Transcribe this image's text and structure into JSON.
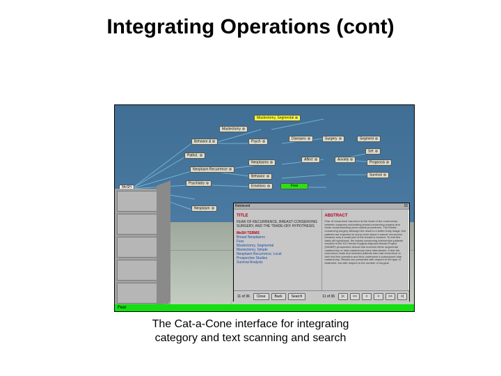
{
  "title": "Integrating Operations (cont)",
  "caption_l1": "The Cat-a-Cone interface for integrating",
  "caption_l2": "category and text scanning and search",
  "status_text": "Fear",
  "root_label": "MeSH",
  "nodes": {
    "n1": "Mastectomy",
    "n2": "Behavior &",
    "n3": "Pathol.",
    "n4": "Mastectomy, Segmental",
    "n5": "Psych",
    "n6": "Neoplasms",
    "n7": "Diseases",
    "n8": "Surgery",
    "n9": "Segment",
    "n10": "Neoplasm Recurrence",
    "n11": "Behavior",
    "n12": "Emotions",
    "n13": "Fear",
    "n14": "Psychiatry",
    "n15": "Affect",
    "n16": "Anxiety",
    "n17": "Set",
    "n18": "Prognosis",
    "n19": "Survival",
    "n20": "Neoplasm"
  },
  "doc": {
    "topbar_left": "Retrieved",
    "topbar_right": "15",
    "title_h": "TITLE",
    "title_lines": "FEAR OF RECURRENCE, BREAST-CONSERVING SURGERY, AND THE TRADE-OFF HYPOTHESIS",
    "mesh_h": "MeSH TERMS",
    "terms": [
      "Breast Neoplasms",
      "Fear",
      "Mastectomy, Segmental",
      "Mastectomy, Simple",
      "Neoplasm Recurrence, Local",
      "Prospective Studies",
      "Survival Analysis"
    ],
    "abs_h": "ABSTRACT",
    "abs": "Fear of recurrence has been at the heart of the controversy between surgeons advocating breast-conserving surgery and those recommending more radical procedures. The breast-conserving surgery although the result is a better body image. But patients are expected to worry more about a cancer recurrence because only a small part of the breast is excised. To test this trade-off hypothesis, the breast-conserving intervention patients enrolled in the DCI breast Surgical Adjuvant Breast Project (NSABP) prospective clinical trial received either segmental mastectomy or total mastectomy were interviewed. A fear the recurrence scale and included patients who had recurrence in their first five operation and thus underwent a subsequent total mastectomy. Results are presented with respect to the type of treatment, but with respect to the number of surgical",
    "buttons": [
      "Close",
      "Back",
      "Search"
    ],
    "count_l": "11 of 36",
    "count_r": "11 of 36"
  },
  "colors": {
    "accent": "#b00020",
    "link": "#184da8",
    "status": "#13e013",
    "highlight": "#2be014"
  }
}
